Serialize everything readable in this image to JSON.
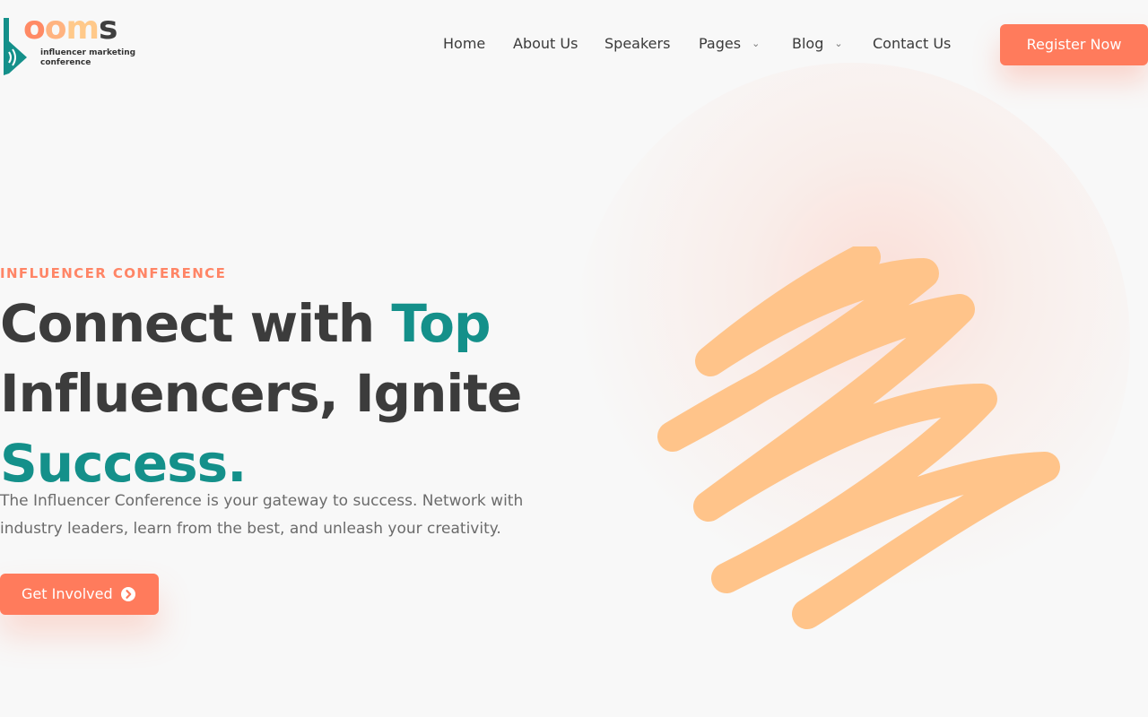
{
  "brand": {
    "wordmark_letters": [
      "o",
      "o",
      "m",
      "s"
    ],
    "tagline_line1": "influencer marketing",
    "tagline_line2": "conference",
    "colors": {
      "teal": "#14908a",
      "coral": "#ff7b5c",
      "peach": "#ffc48a",
      "dark": "#3c3c3c"
    }
  },
  "nav": {
    "items": [
      {
        "label": "Home",
        "has_dropdown": false
      },
      {
        "label": "About Us",
        "has_dropdown": false
      },
      {
        "label": "Speakers",
        "has_dropdown": false
      },
      {
        "label": "Pages",
        "has_dropdown": true
      },
      {
        "label": "Blog",
        "has_dropdown": true
      },
      {
        "label": "Contact Us",
        "has_dropdown": false
      }
    ],
    "dropdown_icon": "chevron-down-icon"
  },
  "header": {
    "register_label": "Register Now"
  },
  "hero": {
    "eyebrow": "INFLUENCER CONFERENCE",
    "headline_part1": "Connect with ",
    "headline_accent1": "Top",
    "headline_part2": "Influencers, Ignite",
    "headline_accent2": "Success.",
    "description": "The Influencer Conference is your gateway to success. Network with industry leaders, learn from the best, and unleash your creativity.",
    "cta_label": "Get Involved",
    "cta_icon": "arrow-circle-right-icon"
  }
}
